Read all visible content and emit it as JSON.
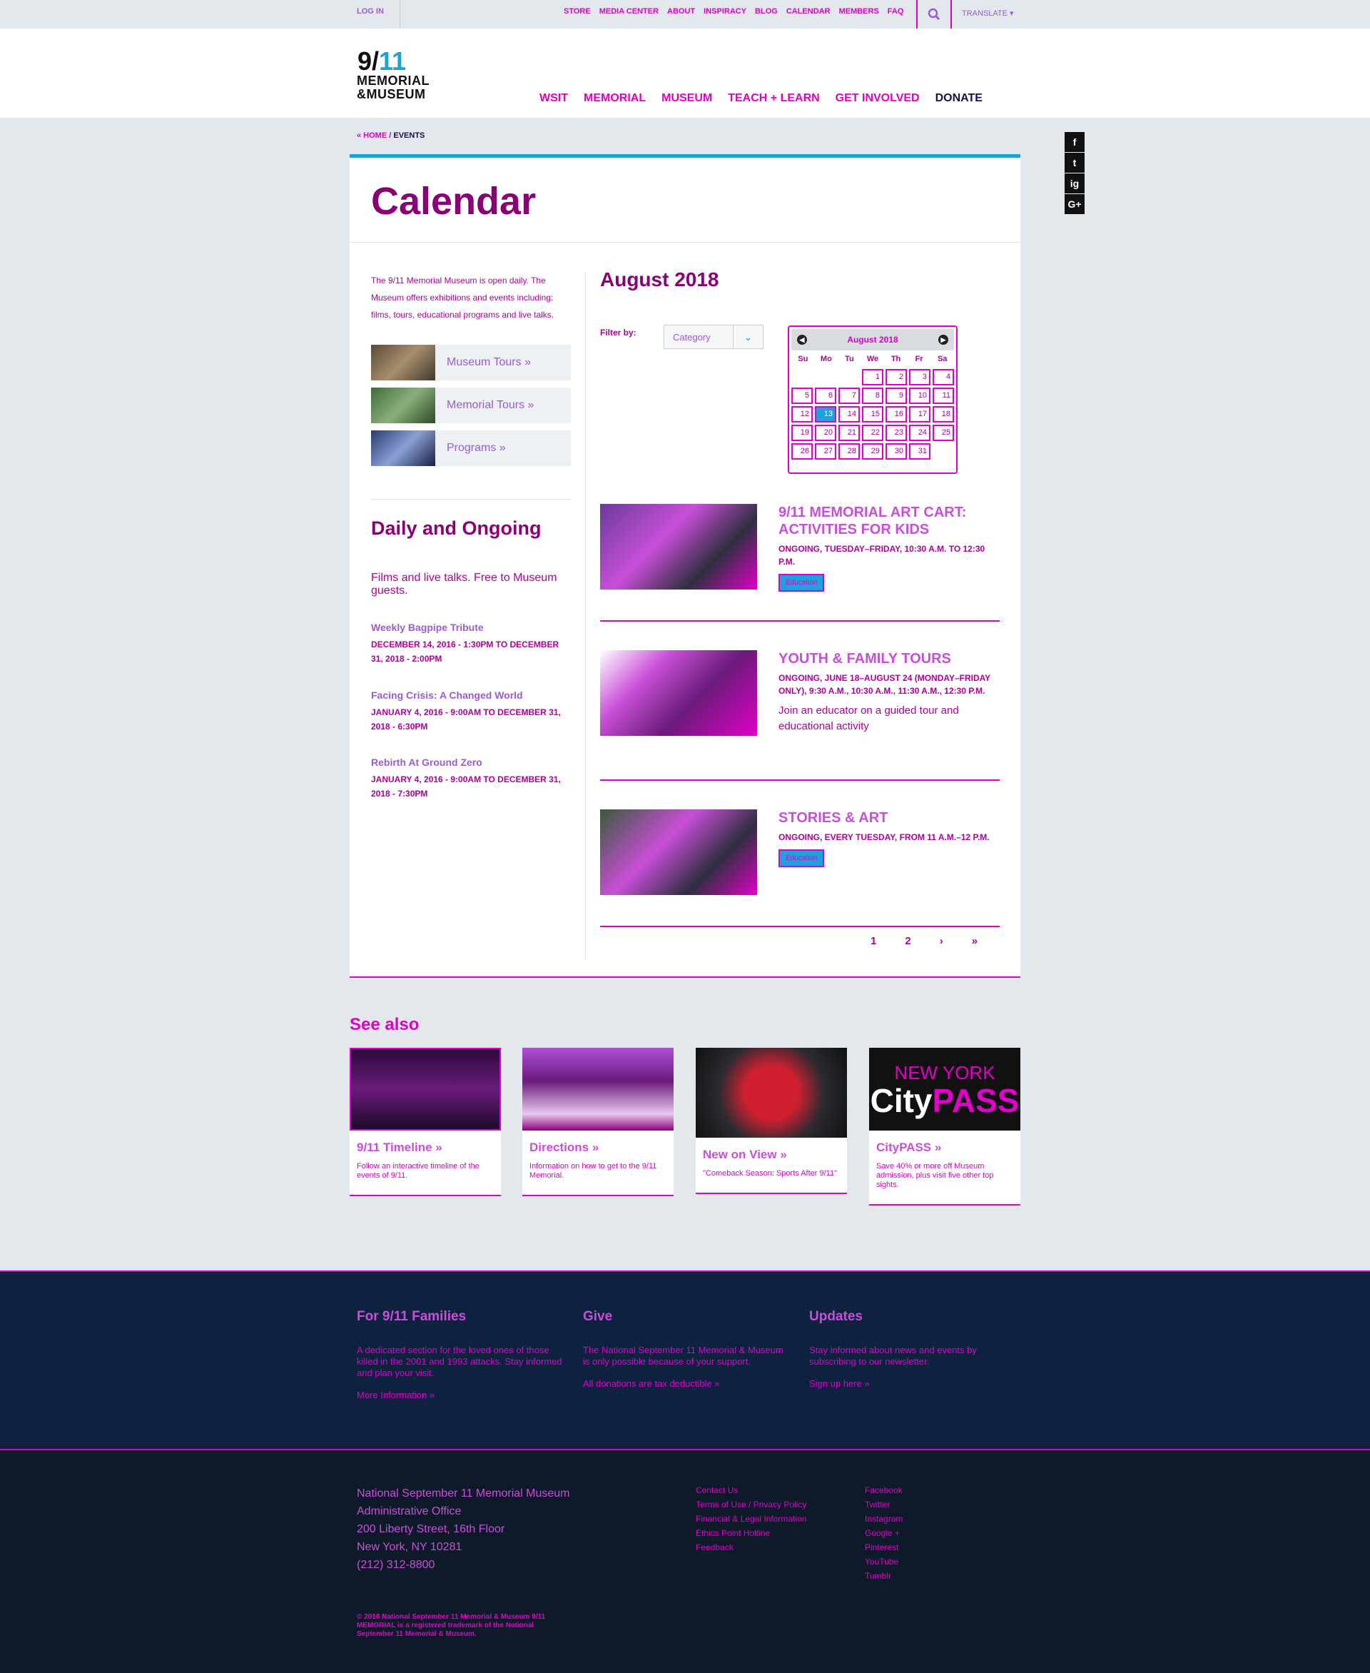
{
  "utility": {
    "login": "LOG IN",
    "links": [
      "STORE",
      "MEDIA CENTER",
      "ABOUT",
      "INSPIRACY",
      "BLOG",
      "CALENDAR",
      "MEMBERS",
      "FAQ"
    ],
    "translate": "TRANSLATE ▾"
  },
  "logo": {
    "top_left": "9/",
    "top_right": "11",
    "line1": "MEMORIAL",
    "line2": "&MUSEUM"
  },
  "nav": [
    "WSIT",
    "MEMORIAL",
    "MUSEUM",
    "TEACH + LEARN",
    "GET INVOLVED",
    "DONATE"
  ],
  "breadcrumb": {
    "home": "« HOME",
    "sep": " / ",
    "current": "EVENTS"
  },
  "social": [
    "f",
    "t",
    "ig",
    "G+"
  ],
  "page": {
    "title": "Calendar"
  },
  "intro": "The 9/11 Memorial Museum is open daily. The Museum offers exhibitions and events including: films, tours, educational programs and live talks.",
  "tours": [
    "Museum Tours »",
    "Memorial Tours »",
    "Programs »"
  ],
  "daily": {
    "title": "Daily and Ongoing",
    "desc": "Films and live talks. Free to Museum guests.",
    "items": [
      {
        "name": "Weekly Bagpipe Tribute",
        "date": "DECEMBER 14, 2016 - 1:30PM TO DECEMBER 31, 2018 - 2:00PM"
      },
      {
        "name": "Facing Crisis: A Changed World",
        "date": "JANUARY 4, 2016 - 9:00AM TO DECEMBER 31, 2018 - 6:30PM"
      },
      {
        "name": "Rebirth At Ground Zero",
        "date": "JANUARY 4, 2016 - 9:00AM TO DECEMBER 31, 2018 - 7:30PM"
      }
    ]
  },
  "month_heading": "August 2018",
  "filter": {
    "label": "Filter by:",
    "value": "Category"
  },
  "calendar": {
    "month": "August 2018",
    "dow": [
      "Su",
      "Mo",
      "Tu",
      "We",
      "Th",
      "Fr",
      "Sa"
    ],
    "lead_blanks": 3,
    "days": 31,
    "today": 13
  },
  "events": [
    {
      "title": "9/11 MEMORIAL ART CART: ACTIVITIES FOR KIDS",
      "date": "ONGOING, TUESDAY–FRIDAY, 10:30 A.M. TO 12:30 P.M.",
      "desc": "",
      "tag": "Education"
    },
    {
      "title": "YOUTH & FAMILY TOURS",
      "date": "ONGOING, JUNE 18–AUGUST 24 (MONDAY–FRIDAY ONLY), 9:30 A.M., 10:30 A.M., 11:30 A.M., 12:30 P.M.",
      "desc": "Join an educator on a guided tour and educational activity",
      "tag": ""
    },
    {
      "title": "STORIES & ART",
      "date": "ONGOING, EVERY TUESDAY, FROM 11 A.M.–12 P.M.",
      "desc": "",
      "tag": "Education"
    }
  ],
  "pager": [
    "1",
    "2",
    "›",
    "»"
  ],
  "see_also": {
    "title": "See also",
    "tiles": [
      {
        "title": "9/11 Timeline »",
        "desc": "Follow an interactive timeline of the events of 9/11."
      },
      {
        "title": "Directions »",
        "desc": "Information on how to get to the 9/11 Memorial."
      },
      {
        "title": "New on View »",
        "desc": "\"Comeback Season: Sports After 9/11\""
      },
      {
        "title": "CityPASS »",
        "desc": "Save 40% or more off Museum admission, plus visit five other top sights.",
        "logo_line1": "NEW YORK",
        "logo_city": "City",
        "logo_pass": "PASS"
      }
    ]
  },
  "footer": {
    "cols": [
      {
        "title": "For 9/11 Families",
        "text": "A dedicated section for the loved ones of those killed in the 2001 and 1993 attacks. Stay informed and plan your visit.",
        "link": "More Information »"
      },
      {
        "title": "Give",
        "text": "The National September 11 Memorial & Museum is only possible because of your support.",
        "link": "All donations are tax deductible »"
      },
      {
        "title": "Updates",
        "text": "Stay informed about news and events by subscribing to our newsletter.",
        "link": "Sign up here »"
      }
    ],
    "address": [
      "National September 11 Memorial Museum",
      "Administrative Office",
      "200 Liberty Street, 16th Floor",
      "New York, NY 10281",
      "(212) 312-8800"
    ],
    "links_a": [
      "Contact Us",
      "Terms of Use / Privacy Policy",
      "Financial & Legal Information",
      "Ethics Point Hotline",
      "Feedback"
    ],
    "links_b": [
      "Facebook",
      "Twitter",
      "Instagram",
      "Google +",
      "Pinterest",
      "YouTube",
      "Tumblr"
    ],
    "copyright": "© 2018 National September 11 Memorial & Museum 9/11 MEMORIAL is a registered trademark of the National September 11 Memorial & Museum."
  }
}
